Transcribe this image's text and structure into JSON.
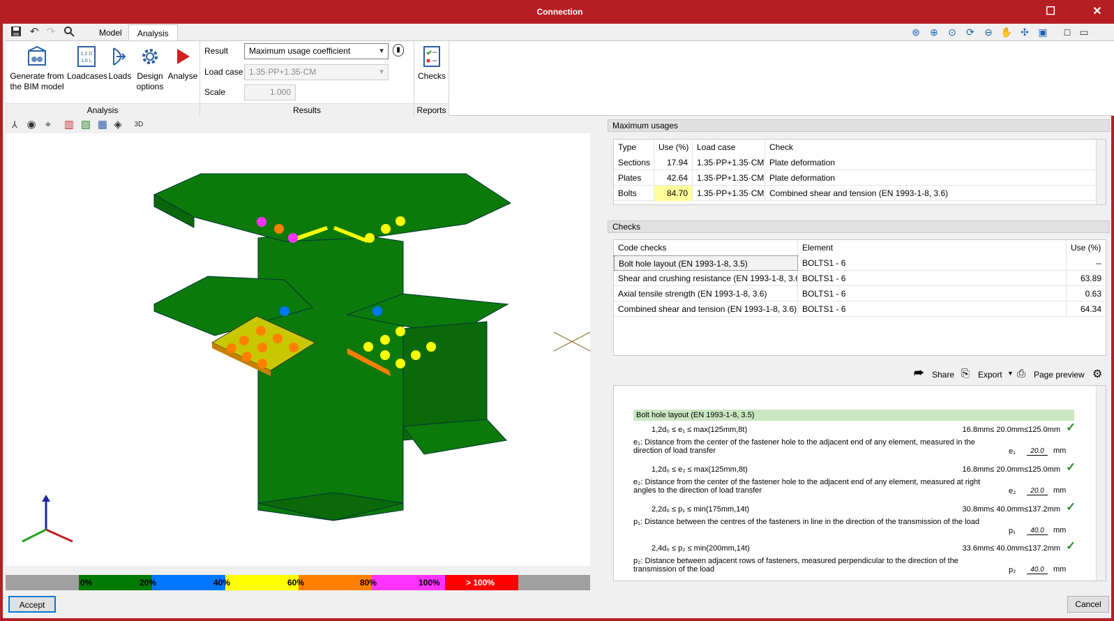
{
  "window": {
    "title": "Connection"
  },
  "tabs": [
    "Model",
    "Analysis"
  ],
  "ribbon": {
    "analysis_group": "Analysis",
    "results_group": "Results",
    "reports_group": "Reports",
    "generate": "Generate from",
    "generate2": "the BIM model",
    "loadcases": "Loadcases",
    "loadcases_icon": "1.2 D\n1.6 L",
    "loads": "Loads",
    "design": "Design",
    "design2": "options",
    "analyse": "Analyse",
    "checks": "Checks",
    "result_label": "Result",
    "result_value": "Maximum usage coefficient",
    "loadcase_label": "Load case",
    "loadcase_value": "1.35·PP+1.35·CM",
    "scale_label": "Scale",
    "scale_value": "1.000"
  },
  "legend": [
    "0%",
    "20%",
    "40%",
    "60%",
    "80%",
    "100%",
    "> 100%"
  ],
  "legend_colors": [
    "#007a00",
    "#0077ff",
    "#ffff00",
    "#ff8000",
    "#ff33ff",
    "#ff0000"
  ],
  "max_usages": {
    "title": "Maximum usages",
    "headers": [
      "Type",
      "Use (%)",
      "Load case",
      "Check"
    ],
    "rows": [
      [
        "Sections",
        "17.94",
        "1.35·PP+1.35·CM",
        "Plate deformation"
      ],
      [
        "Plates",
        "42.64",
        "1.35·PP+1.35·CM",
        "Plate deformation"
      ],
      [
        "Bolts",
        "84.70",
        "1.35·PP+1.35·CM",
        "Combined shear and tension (EN 1993-1-8, 3.6)"
      ]
    ]
  },
  "checks": {
    "title": "Checks",
    "headers": [
      "Code checks",
      "Element",
      "Use (%)"
    ],
    "rows": [
      [
        "Bolt hole layout (EN 1993-1-8, 3.5)",
        "BOLTS1 - 6",
        "--"
      ],
      [
        "Shear and crushing resistance (EN 1993-1-8, 3.6)",
        "BOLTS1 - 6",
        "63.89"
      ],
      [
        "Axial tensile strength (EN 1993-1-8, 3.6)",
        "BOLTS1 - 6",
        "0.63"
      ],
      [
        "Combined shear and tension (EN 1993-1-8, 3.6)",
        "BOLTS1 - 6",
        "64.34"
      ]
    ]
  },
  "report_toolbar": {
    "share": "Share",
    "export": "Export",
    "preview": "Page preview"
  },
  "report": {
    "heading": "Bolt hole layout (EN 1993-1-8, 3.5)",
    "items": [
      {
        "formula": "1,2d₀ ≤ e₁ ≤ max(125mm,8t)",
        "result": "16.8mm≤ 20.0mm≤125.0mm",
        "desc": "e₁: Distance from the center of the fastener hole to the adjacent end of any element, measured in the direction of load transfer",
        "sym": "e₁",
        "val": "20.0",
        "unit": "mm"
      },
      {
        "formula": "1,2d₀ ≤ e₂ ≤ max(125mm,8t)",
        "result": "16.8mm≤ 20.0mm≤125.0mm",
        "desc": "e₂: Distance from the center of the fastener hole to the adjacent end of any element, measured at right angles to the direction of load transfer",
        "sym": "e₂",
        "val": "20.0",
        "unit": "mm"
      },
      {
        "formula": "2,2d₀ ≤ p₁ ≤ min(175mm,14t)",
        "result": "30.8mm≤ 40.0mm≤137.2mm",
        "desc": "p₁: Distance between the centres of the fasteners in line in the direction of the transmission of the load",
        "sym": "p₁",
        "val": "40.0",
        "unit": "mm"
      },
      {
        "formula": "2,4d₀ ≤ p₂ ≤ min(200mm,14t)",
        "result": "33.6mm≤ 40.0mm≤137.2mm",
        "desc": "p₂: Distance between adjacent rows of fasteners, measured perpendicular to the direction of the transmission of the load",
        "sym": "p₂",
        "val": "40.0",
        "unit": "mm"
      }
    ]
  },
  "footer": {
    "accept": "Accept",
    "cancel": "Cancel"
  }
}
